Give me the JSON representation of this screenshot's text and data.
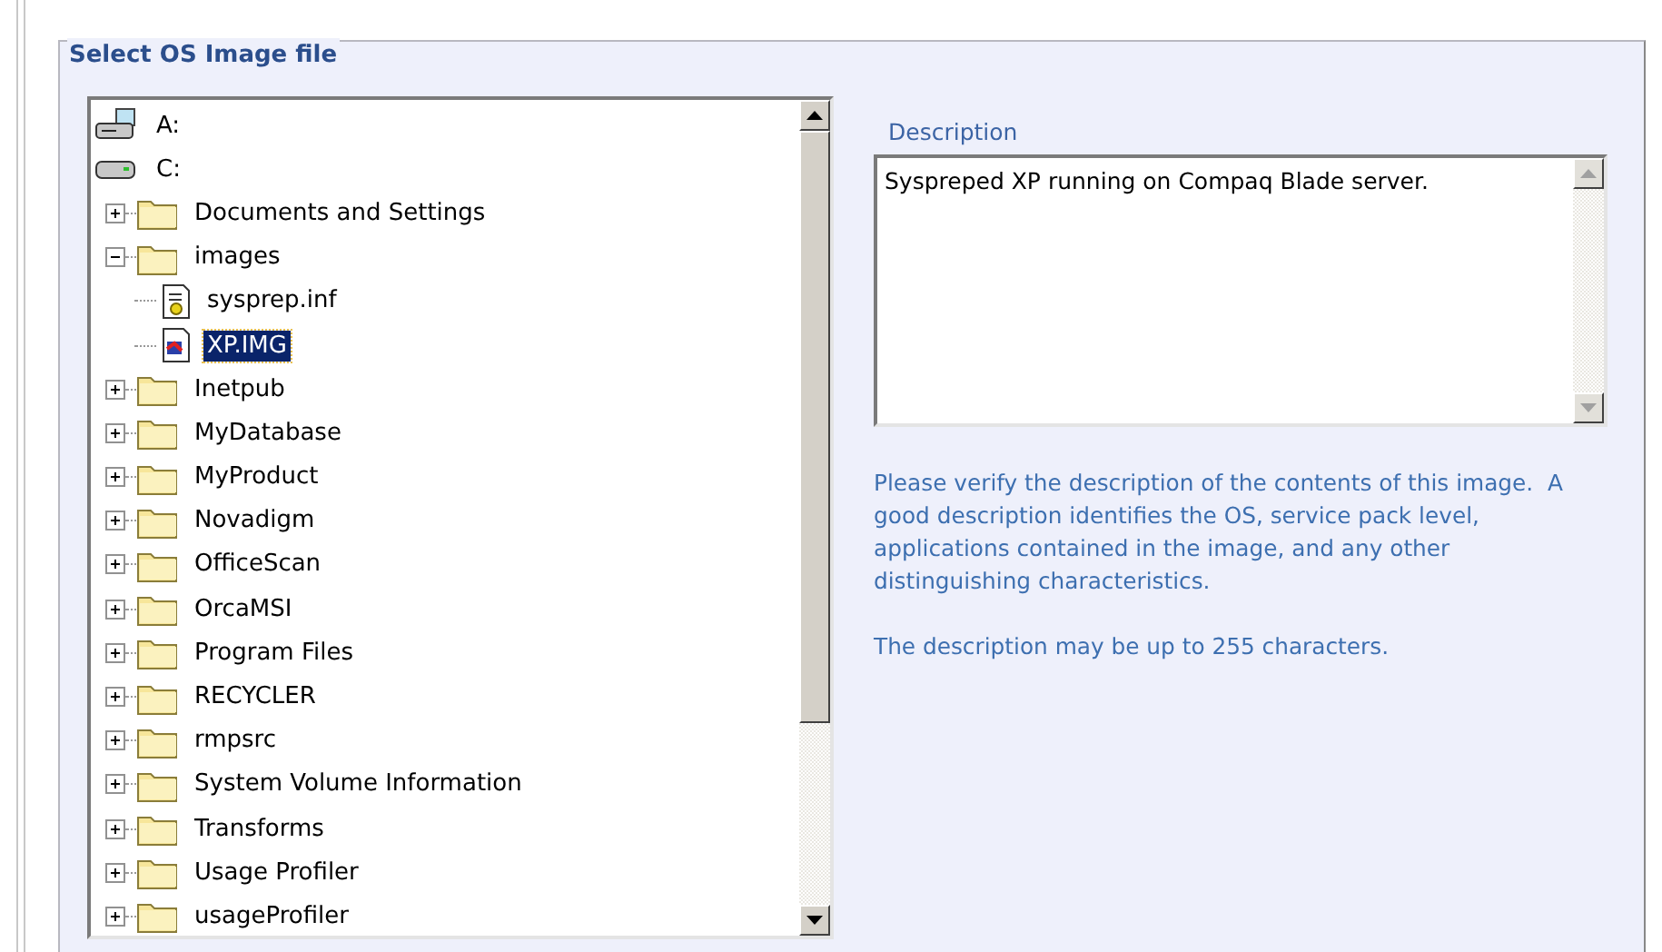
{
  "group": {
    "title": "Select OS Image file"
  },
  "tree": {
    "items": [
      {
        "label": "A:",
        "kind": "floppy",
        "selected": false
      },
      {
        "label": "C:",
        "kind": "drive",
        "selected": false,
        "children": [
          {
            "label": "Documents and Settings",
            "kind": "folder",
            "expanded": false,
            "selected": false
          },
          {
            "label": "images",
            "kind": "folder",
            "expanded": true,
            "selected": false,
            "children": [
              {
                "label": "sysprep.inf",
                "kind": "settings-file",
                "selected": false
              },
              {
                "label": "XP.IMG",
                "kind": "image-file",
                "selected": true
              }
            ]
          },
          {
            "label": "Inetpub",
            "kind": "folder",
            "expanded": false,
            "selected": false
          },
          {
            "label": "MyDatabase",
            "kind": "folder",
            "expanded": false,
            "selected": false
          },
          {
            "label": "MyProduct",
            "kind": "folder",
            "expanded": false,
            "selected": false
          },
          {
            "label": "Novadigm",
            "kind": "folder",
            "expanded": false,
            "selected": false
          },
          {
            "label": "OfficeScan",
            "kind": "folder",
            "expanded": false,
            "selected": false
          },
          {
            "label": "OrcaMSI",
            "kind": "folder",
            "expanded": false,
            "selected": false
          },
          {
            "label": "Program Files",
            "kind": "folder",
            "expanded": false,
            "selected": false
          },
          {
            "label": "RECYCLER",
            "kind": "folder",
            "expanded": false,
            "selected": false
          },
          {
            "label": "rmpsrc",
            "kind": "folder",
            "expanded": false,
            "selected": false
          },
          {
            "label": "System Volume Information",
            "kind": "folder",
            "expanded": false,
            "selected": false
          },
          {
            "label": "Transforms",
            "kind": "folder",
            "expanded": false,
            "selected": false
          },
          {
            "label": "Usage Profiler",
            "kind": "folder",
            "expanded": false,
            "selected": false
          },
          {
            "label": "usageProfiler",
            "kind": "folder",
            "expanded": false,
            "selected": false
          }
        ]
      }
    ]
  },
  "description": {
    "label": "Description",
    "value": "Syspreped XP running on Compaq Blade server."
  },
  "help": [
    "Please verify the description of the contents of this image.  A good description identifies the OS, service pack level, applications contained in the image, and any other distinguishing characteristics.",
    "The description may be up to 255 characters."
  ]
}
